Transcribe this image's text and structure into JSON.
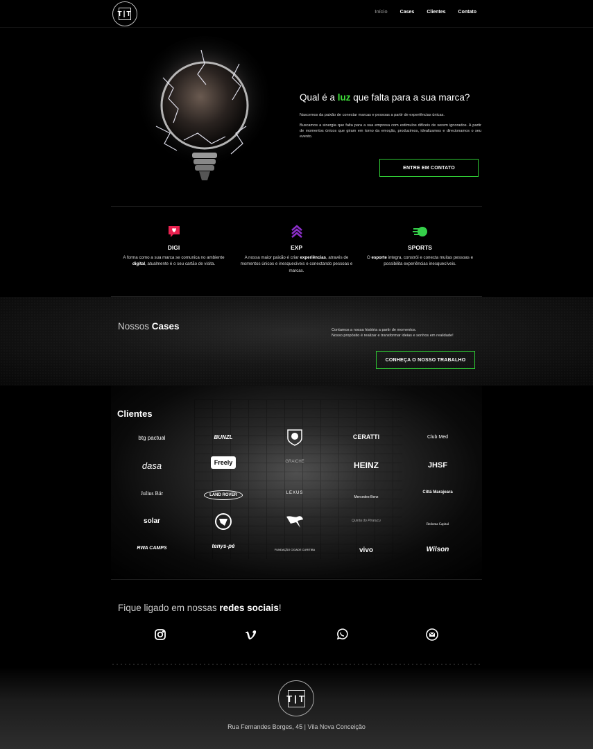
{
  "nav": {
    "items": [
      {
        "label": "Início",
        "active": true
      },
      {
        "label": "Cases",
        "active": false
      },
      {
        "label": "Clientes",
        "active": false
      },
      {
        "label": "Contato",
        "active": false
      }
    ],
    "logo_text": "T|T"
  },
  "hero": {
    "title_pre": "Qual é a ",
    "title_highlight": "luz",
    "title_post": " que falta para a sua marca?",
    "p1": "Nascemos da paixão de conectar marcas e pessoas a partir de experiências únicas.",
    "p2": "Buscamos a sinergia que falta para a sua empresa com estímulos difíceis de serem ignorados. A partir de momentos únicos que giram em torno da emoção, produzimos, idealizamos e direcionamos o seu evento.",
    "cta": "ENTRE EM CONTATO"
  },
  "services": [
    {
      "icon": "heart-chat-icon",
      "color": "#e8214f",
      "name": "DIGI",
      "desc_pre": "A forma como a sua marca se comunica no ambiente ",
      "desc_bold": "digital",
      "desc_post": ", atualmente é o seu cartão de visita."
    },
    {
      "icon": "chevrons-up-icon",
      "color": "#8b2fc9",
      "name": "EXP",
      "desc_pre": "A nossa maior paixão é criar ",
      "desc_bold": "experiências",
      "desc_post": ", através de momentos únicos e inesquecíveis e conectando pessoas e marcas."
    },
    {
      "icon": "speeding-ball-icon",
      "color": "#35d04a",
      "name": "SPORTS",
      "desc_pre": "O ",
      "desc_bold": "esporte",
      "desc_post": " integra, constrói e conecta muitas pessoas e possibilita experiências inesquecíveis."
    }
  ],
  "cases": {
    "title_pre": "Nossos ",
    "title_bold": "Cases",
    "line1": "Contamos a nossa história a partir de momentos.",
    "line2": "Nosso propósito é realizar e transformar ideias e sonhos em realidade!",
    "cta": "CONHEÇA O NOSSO TRABALHO"
  },
  "clients": {
    "title": "Clientes",
    "logos": [
      "btg pactual",
      "BUNZL",
      "crest",
      "CERATTI",
      "Club Med",
      "dasa",
      "Freely",
      "GRAICHE",
      "HEINZ",
      "JHSF",
      "Julius Bär",
      "LAND ROVER",
      "LEXUS",
      "Mercedes-Benz",
      "Cittá Marajoara",
      "solar",
      "crest2",
      "PUMA",
      "Quinta do Pirarucu",
      "Redoma Capital",
      "RWA CAMPS",
      "tenys-pé",
      "FUNDAÇÃO CIDADE CURITIBA",
      "vivo",
      "Wilson"
    ]
  },
  "social": {
    "title_pre": "Fique ligado em nossas ",
    "title_bold": "redes sociais",
    "title_post": "!",
    "icons": [
      "instagram-icon",
      "vimeo-icon",
      "whatsapp-icon",
      "email-icon"
    ]
  },
  "footer": {
    "address": "Rua Fernandes Borges, 45 | Vila Nova Conceição"
  },
  "colors": {
    "accent_green": "#2fc834",
    "highlight_green": "#3fe03a"
  }
}
